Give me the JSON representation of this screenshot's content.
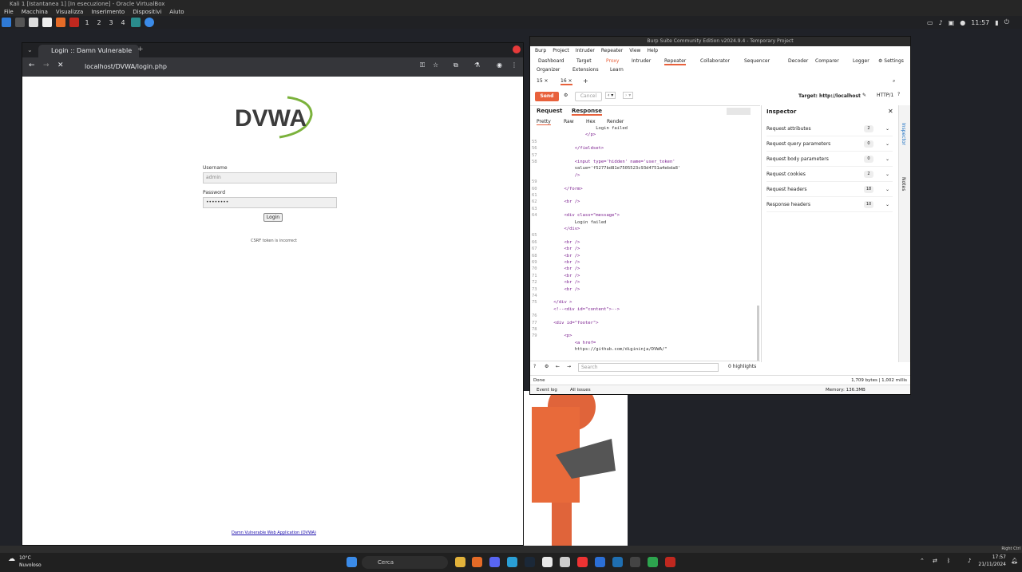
{
  "host": {
    "title": "Kali 1 [Istantanea 1] [In esecuzione] - Oracle VirtualBox",
    "menu": [
      "File",
      "Macchina",
      "Visualizza",
      "Inserimento",
      "Dispositivi",
      "Aiuto"
    ],
    "workspaces": [
      "1",
      "2",
      "3",
      "4"
    ],
    "panel_time": "11:57",
    "statusbar_text": "Right Ctrl"
  },
  "chrome": {
    "tab_title": "Login :: Damn Vulnerable",
    "url": "localhost/DVWA/login.php",
    "logo_text": "DVWA",
    "username_label": "Username",
    "username_value": "admin",
    "password_label": "Password",
    "password_value": "••••••••",
    "login_button": "Login",
    "message": "CSRF token is incorrect",
    "footer_link": "Damn Vulnerable Web Application (DVWA)"
  },
  "burp": {
    "title": "Burp Suite Community Edition v2024.9.4 - Temporary Project",
    "menu": [
      "Burp",
      "Project",
      "Intruder",
      "Repeater",
      "View",
      "Help"
    ],
    "tabs_row1": [
      "Dashboard",
      "Target",
      "Proxy",
      "Intruder",
      "Repeater",
      "Collaborator",
      "Sequencer",
      "Decoder",
      "Comparer",
      "Logger",
      "Settings"
    ],
    "tabs_row2": [
      "Organizer",
      "Extensions",
      "Learn"
    ],
    "subtabs": [
      "15 ×",
      "16 ×",
      "+"
    ],
    "send": "Send",
    "cancel": "Cancel",
    "target": "Target: http://localhost",
    "http": "HTTP/1",
    "request_tab": "Request",
    "response_tab": "Response",
    "view_tabs": [
      "Pretty",
      "Raw",
      "Hex",
      "Render"
    ],
    "code_lines": [
      {
        "n": "",
        "t": "                    Login failed"
      },
      {
        "n": "",
        "t": "                </p>"
      },
      {
        "n": "55",
        "t": ""
      },
      {
        "n": "56",
        "t": "            </fieldset>"
      },
      {
        "n": "57",
        "t": ""
      },
      {
        "n": "58",
        "t": "            <input type='hidden' name='user_token'"
      },
      {
        "n": "",
        "t": "            value='f5277bd81e7505523c93d4751a4ebda8'"
      },
      {
        "n": "",
        "t": "            />"
      },
      {
        "n": "59",
        "t": ""
      },
      {
        "n": "60",
        "t": "        </form>"
      },
      {
        "n": "61",
        "t": ""
      },
      {
        "n": "62",
        "t": "        <br />"
      },
      {
        "n": "63",
        "t": ""
      },
      {
        "n": "64",
        "t": "        <div class=\"message\">"
      },
      {
        "n": "",
        "t": "            Login failed"
      },
      {
        "n": "",
        "t": "        </div>"
      },
      {
        "n": "65",
        "t": ""
      },
      {
        "n": "66",
        "t": "        <br />"
      },
      {
        "n": "67",
        "t": "        <br />"
      },
      {
        "n": "68",
        "t": "        <br />"
      },
      {
        "n": "69",
        "t": "        <br />"
      },
      {
        "n": "70",
        "t": "        <br />"
      },
      {
        "n": "71",
        "t": "        <br />"
      },
      {
        "n": "72",
        "t": "        <br />"
      },
      {
        "n": "73",
        "t": "        <br />"
      },
      {
        "n": "74",
        "t": ""
      },
      {
        "n": "75",
        "t": "    </div >"
      },
      {
        "n": "",
        "t": "    <!--<div id=\"content\">-->"
      },
      {
        "n": "76",
        "t": ""
      },
      {
        "n": "77",
        "t": "    <div id=\"footer\">"
      },
      {
        "n": "78",
        "t": ""
      },
      {
        "n": "79",
        "t": "        <p>"
      },
      {
        "n": "",
        "t": "            <a href="
      },
      {
        "n": "",
        "t": "            https://github.com/digininja/DVWA/\""
      }
    ],
    "search_placeholder": "Search",
    "highlights": "0 highlights",
    "inspector_title": "Inspector",
    "inspector_rows": [
      {
        "label": "Request attributes",
        "count": "2"
      },
      {
        "label": "Request query parameters",
        "count": "0"
      },
      {
        "label": "Request body parameters",
        "count": "0"
      },
      {
        "label": "Request cookies",
        "count": "2"
      },
      {
        "label": "Request headers",
        "count": "18"
      },
      {
        "label": "Response headers",
        "count": "10"
      }
    ],
    "rail_inspector": "Inspector",
    "rail_notes": "Notes",
    "status_left": "Done",
    "status_right": "1,709 bytes | 1,002 millis",
    "bottom_event": "Event log",
    "bottom_issues": "All issues",
    "memory": "Memory: 136.3MB"
  },
  "taskbar": {
    "weather_temp": "10°C",
    "weather_desc": "Nuvoloso",
    "search": "Cerca",
    "time": "17:57",
    "date": "21/11/2024"
  }
}
